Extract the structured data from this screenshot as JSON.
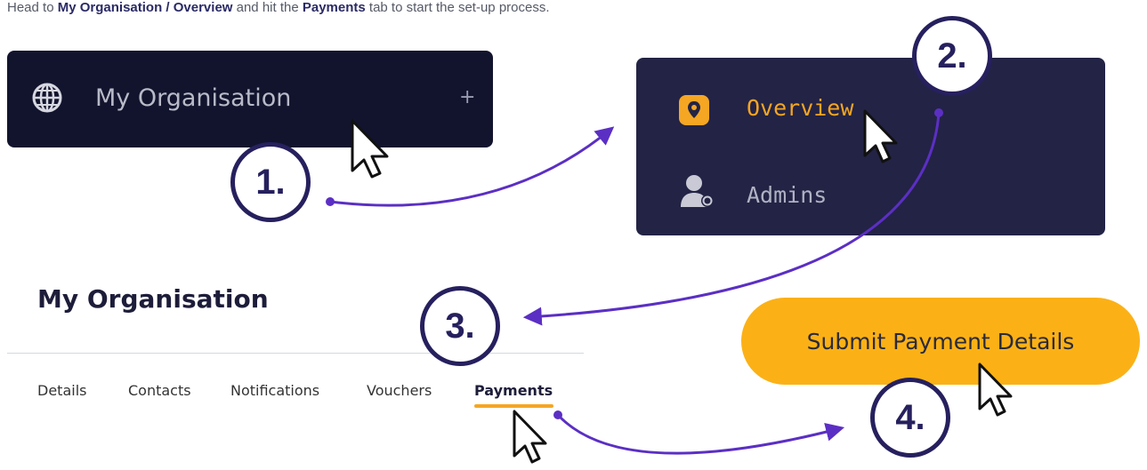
{
  "intro": {
    "prefix": "Head to ",
    "path_label": "My Organisation / Overview",
    "middle": " and hit the ",
    "tab_label": "Payments",
    "suffix": " tab to start the set-up process."
  },
  "panel1": {
    "icon": "globe-icon",
    "label": "My Organisation",
    "expand_symbol": "+"
  },
  "panel2": {
    "items": [
      {
        "icon": "location-pin-icon",
        "label": "Overview",
        "color": "#f5a623"
      },
      {
        "icon": "admin-user-icon",
        "label": "Admins"
      }
    ]
  },
  "section3": {
    "title": "My Organisation",
    "tabs": [
      {
        "label": "Details"
      },
      {
        "label": "Contacts"
      },
      {
        "label": "Notifications"
      },
      {
        "label": "Vouchers"
      },
      {
        "label": "Payments",
        "active": true
      }
    ]
  },
  "submit_button": {
    "label": "Submit Payment Details",
    "color": "#fbb116"
  },
  "steps": [
    "1.",
    "2.",
    "3.",
    "4."
  ],
  "colors": {
    "accent": "#f5a623",
    "arrow": "#5b2fc4",
    "step_outline": "#26205e"
  }
}
